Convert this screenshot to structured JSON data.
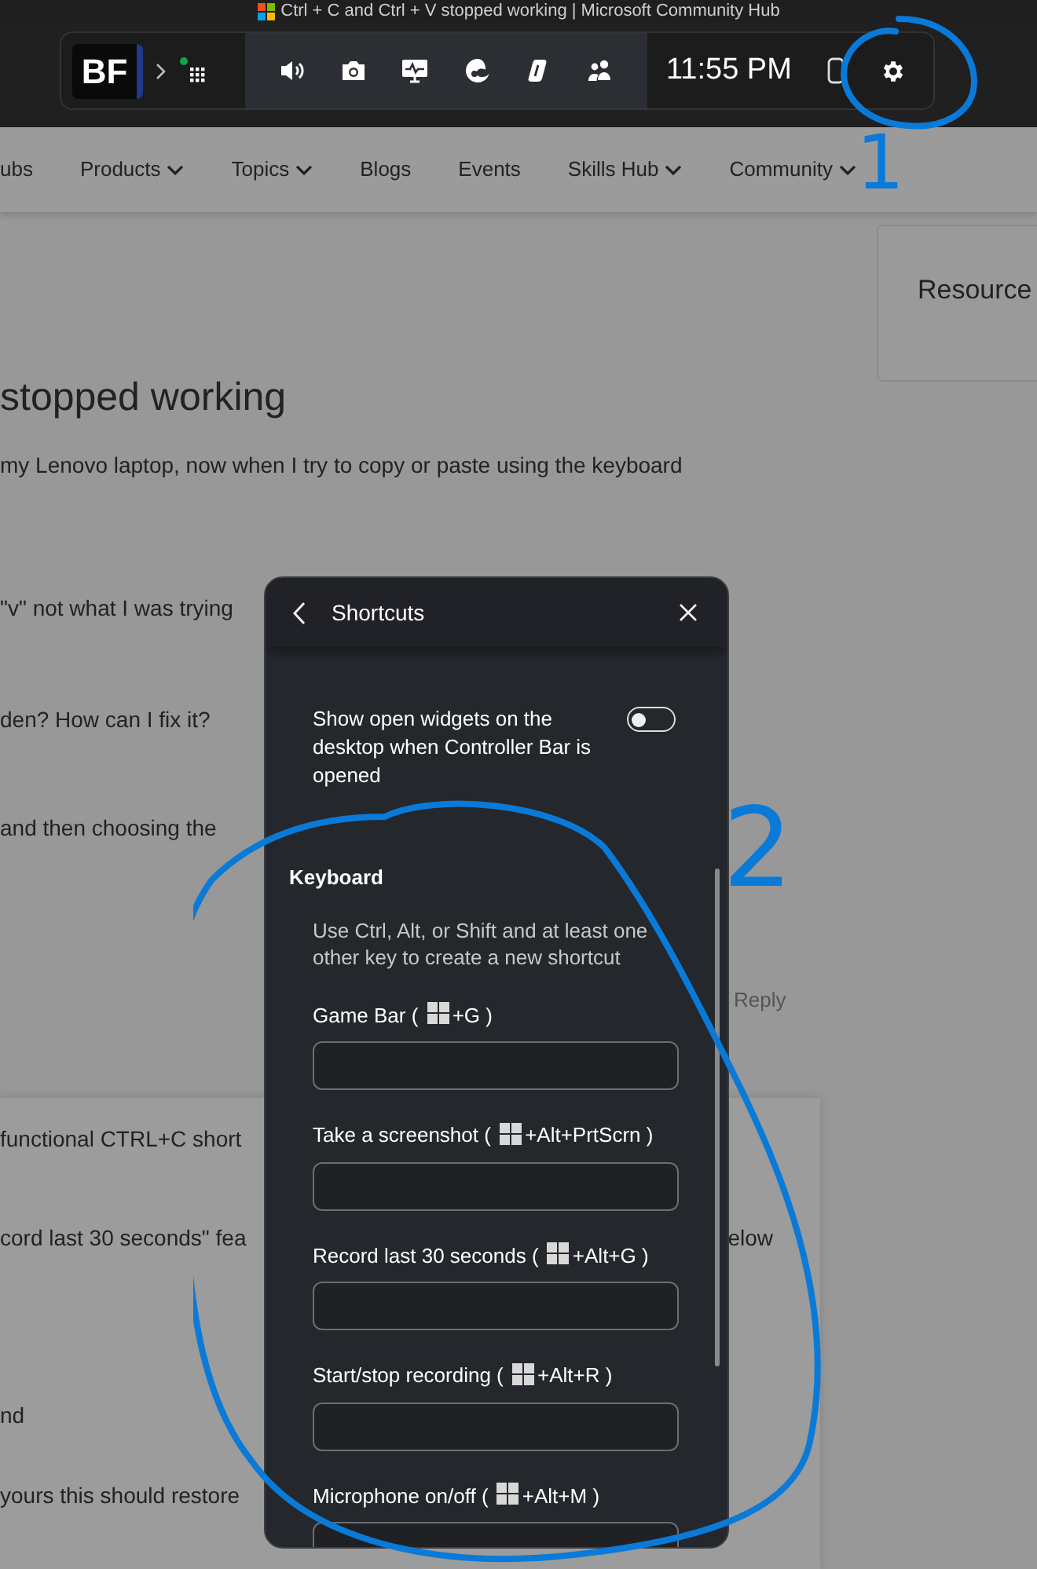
{
  "window": {
    "title": "Ctrl + C and Ctrl + V stopped working | Microsoft Community Hub"
  },
  "game_bar": {
    "logo": "BF",
    "time": "11:55 PM",
    "widgets": [
      {
        "kind": "volume"
      },
      {
        "kind": "camera"
      },
      {
        "kind": "performance"
      },
      {
        "kind": "browser"
      },
      {
        "kind": "copilot"
      },
      {
        "kind": "people"
      }
    ]
  },
  "nav": {
    "items": [
      {
        "label": "ubs",
        "dropdown": false
      },
      {
        "label": "Products",
        "dropdown": true
      },
      {
        "label": "Topics",
        "dropdown": true
      },
      {
        "label": "Blogs",
        "dropdown": false
      },
      {
        "label": "Events",
        "dropdown": false
      },
      {
        "label": "Skills Hub",
        "dropdown": true
      },
      {
        "label": "Community",
        "dropdown": true
      }
    ]
  },
  "sidebar": {
    "title": "Resource"
  },
  "post": {
    "title": "stopped working",
    "lines": [
      "my Lenovo laptop, now when I try to copy or paste using the keyboard",
      "\"v\" not what I was trying",
      "den?  How can I fix it?",
      "and then choosing the"
    ],
    "reply": "Reply"
  },
  "answer": {
    "lines": [
      {
        "left": "functional CTRL+C short"
      },
      {
        "left": "cord last 30 seconds\" fea",
        "right": "elow"
      },
      {
        "left": "nd"
      },
      {
        "left": "yours this should restore"
      }
    ]
  },
  "panel": {
    "title": "Shortcuts",
    "toggle": {
      "label": "Show open widgets on the desktop when Controller Bar is opened",
      "on": false
    },
    "section": "Keyboard",
    "hint": "Use Ctrl, Alt, or Shift and at least one other key to create a new shortcut",
    "shortcuts": [
      {
        "label": "Game Bar (",
        "keys": "+G )"
      },
      {
        "label": "Take a screenshot (",
        "keys": "+Alt+PrtScrn )"
      },
      {
        "label": "Record last 30 seconds (",
        "keys": "+Alt+G )"
      },
      {
        "label": "Start/stop recording (",
        "keys": "+Alt+R )"
      },
      {
        "label": "Microphone on/off (",
        "keys": "+Alt+M )"
      }
    ]
  },
  "annotations": [
    "1",
    "2"
  ]
}
